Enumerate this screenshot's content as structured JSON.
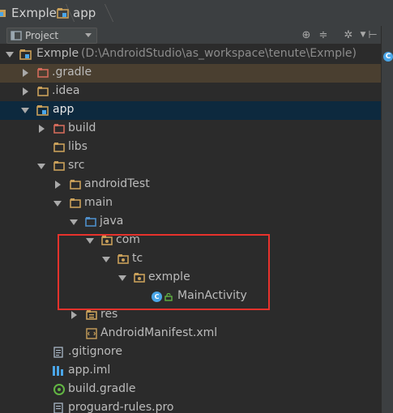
{
  "breadcrumb": {
    "project": "Exmple",
    "module": "app"
  },
  "toolbar": {
    "view_label": "Project"
  },
  "tree": {
    "root": {
      "name": "Exmple",
      "path": "(D:\\AndroidStudio\\as_workspace\\tenute\\Exmple)"
    },
    "gradle_dir": ".gradle",
    "idea_dir": ".idea",
    "app": "app",
    "build": "build",
    "libs": "libs",
    "src": "src",
    "androidTest": "androidTest",
    "main": "main",
    "java": "java",
    "com": "com",
    "tc": "tc",
    "exmple": "exmple",
    "main_activity": "MainActivity",
    "res": "res",
    "manifest": "AndroidManifest.xml",
    "gitignore": ".gitignore",
    "app_iml": "app.iml",
    "build_gradle": "build.gradle",
    "proguard": "proguard-rules.pro"
  },
  "colors": {
    "selection": "#0d293e",
    "highlight_row": "#4a3f30",
    "annotation_box": "#e8322c",
    "folder": "#c9a05a",
    "class_icon": "#4aa6e8"
  }
}
